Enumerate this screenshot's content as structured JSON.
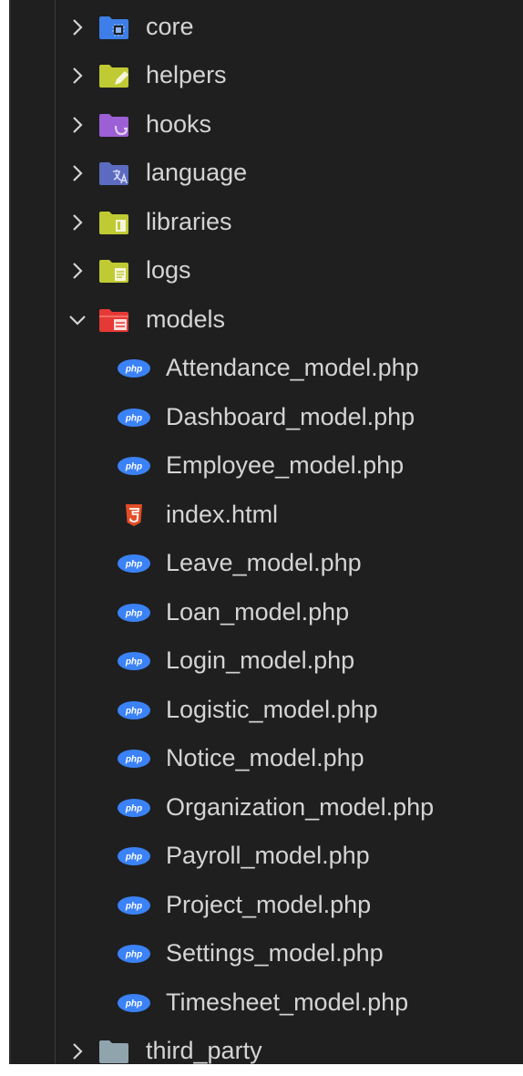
{
  "explorer": {
    "folders_top": [
      {
        "id": "core",
        "label": "core",
        "icon": "folder-core-icon",
        "color": "#3d7ee8",
        "expanded": false
      },
      {
        "id": "helpers",
        "label": "helpers",
        "icon": "folder-helpers-icon",
        "color": "#c0ca33",
        "expanded": false
      },
      {
        "id": "hooks",
        "label": "hooks",
        "icon": "folder-hooks-icon",
        "color": "#9c5fd6",
        "expanded": false
      },
      {
        "id": "language",
        "label": "language",
        "icon": "folder-language-icon",
        "color": "#5c6bc0",
        "expanded": false
      },
      {
        "id": "libraries",
        "label": "libraries",
        "icon": "folder-libraries-icon",
        "color": "#c0ca33",
        "expanded": false
      },
      {
        "id": "logs",
        "label": "logs",
        "icon": "folder-logs-icon",
        "color": "#c0ca33",
        "expanded": false
      },
      {
        "id": "models",
        "label": "models",
        "icon": "folder-models-icon",
        "color": "#e53935",
        "expanded": true
      }
    ],
    "model_files": [
      {
        "label": "Attendance_model.php",
        "icon": "php-icon"
      },
      {
        "label": "Dashboard_model.php",
        "icon": "php-icon"
      },
      {
        "label": "Employee_model.php",
        "icon": "php-icon"
      },
      {
        "label": "index.html",
        "icon": "html5-icon"
      },
      {
        "label": "Leave_model.php",
        "icon": "php-icon"
      },
      {
        "label": "Loan_model.php",
        "icon": "php-icon"
      },
      {
        "label": "Login_model.php",
        "icon": "php-icon"
      },
      {
        "label": "Logistic_model.php",
        "icon": "php-icon"
      },
      {
        "label": "Notice_model.php",
        "icon": "php-icon"
      },
      {
        "label": "Organization_model.php",
        "icon": "php-icon"
      },
      {
        "label": "Payroll_model.php",
        "icon": "php-icon"
      },
      {
        "label": "Project_model.php",
        "icon": "php-icon"
      },
      {
        "label": "Settings_model.php",
        "icon": "php-icon"
      },
      {
        "label": "Timesheet_model.php",
        "icon": "php-icon"
      }
    ],
    "folders_bottom": [
      {
        "id": "third_party",
        "label": "third_party",
        "icon": "folder-icon",
        "color": "#90a4ae",
        "expanded": false
      }
    ],
    "colors": {
      "background": "#1f1f1f",
      "text": "#d4d4d4",
      "php": "#3b82f6",
      "html5": "#e44d26"
    }
  }
}
